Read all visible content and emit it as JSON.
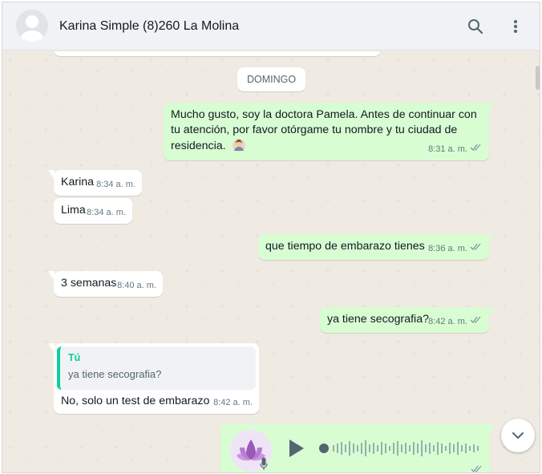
{
  "header": {
    "contact_name": "Karina Simple (8)260 La Molina",
    "search_icon": "search-icon",
    "menu_icon": "vertical-dots-icon"
  },
  "date_divider": "DOMINGO",
  "messages": [
    {
      "direction": "out",
      "text": "Mucho gusto, soy la doctora Pamela. Antes de continuar con tu atención, por favor otórgame tu nombre y tu ciudad de residencia.",
      "emoji": "woman-doctor-emoji",
      "time": "8:31 a. m.",
      "status": "double-check"
    },
    {
      "direction": "in",
      "text": "Karina",
      "time": "8:34 a. m."
    },
    {
      "direction": "in",
      "text": "Lima",
      "time": "8:34 a. m."
    },
    {
      "direction": "out",
      "text": "que tiempo de embarazo tienes",
      "time": "8:36 a. m.",
      "status": "double-check"
    },
    {
      "direction": "in",
      "text": "3 semanas",
      "time": "8:40 a. m."
    },
    {
      "direction": "out",
      "text": "ya tiene secografia?",
      "time": "8:42 a. m.",
      "status": "double-check"
    },
    {
      "direction": "in",
      "quoted_author": "Tú",
      "quoted_text": "ya tiene secografia?",
      "text": "No, solo un test de embarazo",
      "time": "8:42 a. m."
    },
    {
      "direction": "out",
      "type": "audio",
      "avatar_icon": "lotus-avatar-icon",
      "play_icon": "play-icon",
      "mic_icon": "mic-icon",
      "status": "double-check"
    }
  ],
  "scroll_down_icon": "chevron-down-icon",
  "colors": {
    "outgoing_bubble": "#d9fdd3",
    "incoming_bubble": "#ffffff",
    "chat_background": "#efeae2",
    "quote_accent": "#06cf9c",
    "read_check": "#8696a0"
  }
}
